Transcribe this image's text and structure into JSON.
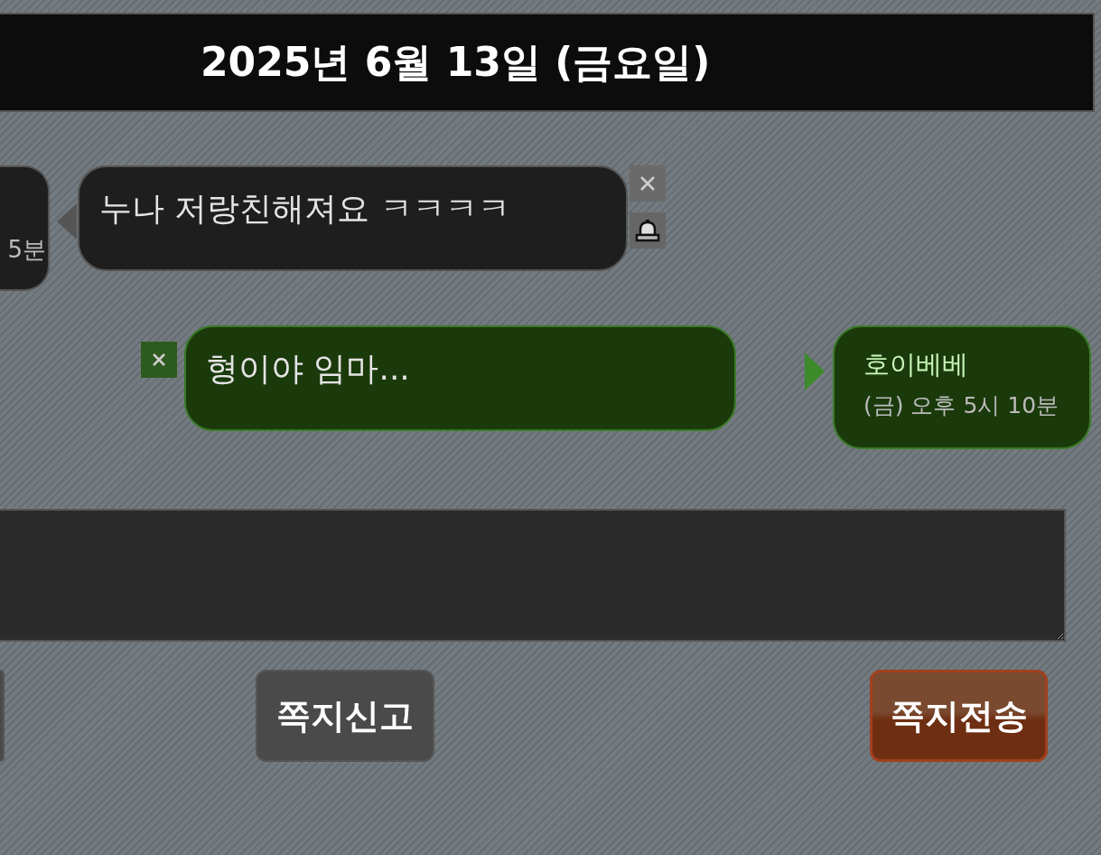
{
  "date_header": "2025년 6월 13일 (금요일)",
  "messages": [
    {
      "kind": "received",
      "time": "5분",
      "text": "누나 저랑친해져요 ㅋㅋㅋㅋ"
    },
    {
      "kind": "sent",
      "text": "형이야 임마...",
      "sender": "호이베베",
      "time": "(금) 오후 5시 10분"
    }
  ],
  "buttons": [
    {
      "kind": "cut"
    },
    {
      "kind": "report",
      "label": "쪽지신고"
    },
    {
      "kind": "send",
      "label": "쪽지전송"
    }
  ]
}
